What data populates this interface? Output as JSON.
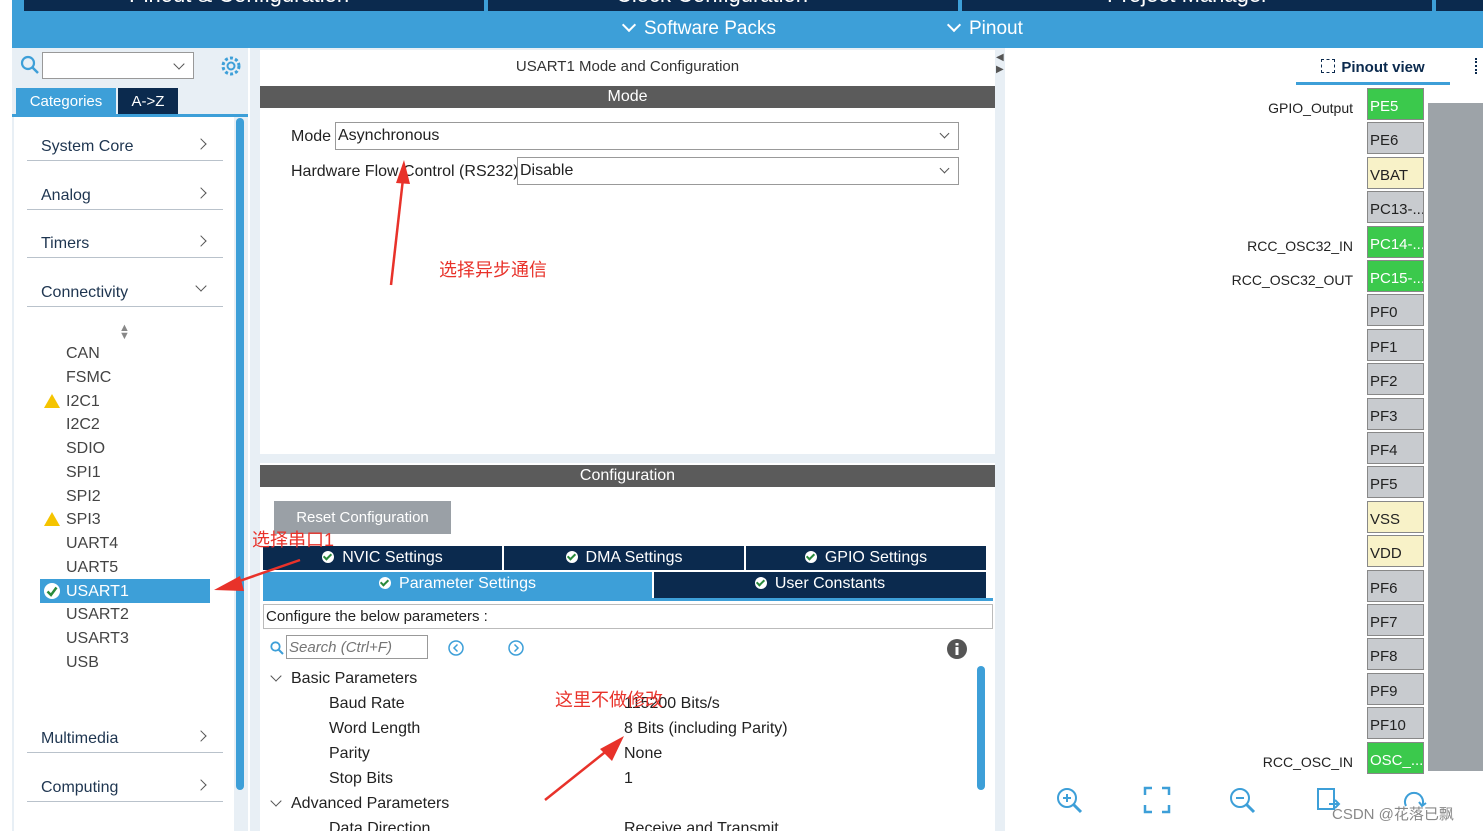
{
  "header": {
    "top_tabs": [
      "Pinout & Configuration",
      "Clock Configuration",
      "Project Manager"
    ],
    "sub_nav": [
      "Software Packs",
      "Pinout"
    ]
  },
  "left": {
    "search_value": "",
    "tabs": [
      "Categories",
      "A->Z"
    ],
    "categories": [
      "System Core",
      "Analog",
      "Timers",
      "Connectivity",
      "Multimedia",
      "Computing"
    ],
    "connectivity_items": [
      "CAN",
      "FSMC",
      "I2C1",
      "I2C2",
      "SDIO",
      "SPI1",
      "SPI2",
      "SPI3",
      "UART4",
      "UART5",
      "USART1",
      "USART2",
      "USART3",
      "USB"
    ],
    "warnings": [
      "I2C1",
      "SPI3"
    ],
    "selected": "USART1"
  },
  "middle": {
    "title": "USART1 Mode and Configuration",
    "mode_bar": "Mode",
    "mode_label": "Mode",
    "mode_value": "Asynchronous",
    "flow_label": "Hardware Flow Control (RS232)",
    "flow_value": "Disable",
    "config_bar": "Configuration",
    "reset_btn": "Reset Configuration",
    "tabs_row1": [
      "NVIC Settings",
      "DMA Settings",
      "GPIO Settings"
    ],
    "tabs_row2": [
      "Parameter Settings",
      "User Constants"
    ],
    "configure_text": "Configure the below parameters :",
    "search_placeholder": "Search (Ctrl+F)",
    "basic_section": "Basic Parameters",
    "params": [
      {
        "label": "Baud Rate",
        "value": "115200 Bits/s"
      },
      {
        "label": "Word Length",
        "value": "8 Bits (including Parity)"
      },
      {
        "label": "Parity",
        "value": "None"
      },
      {
        "label": "Stop Bits",
        "value": "1"
      }
    ],
    "advanced_section": "Advanced Parameters",
    "advanced_first": {
      "label": "Data Direction",
      "value": "Receive and Transmit"
    }
  },
  "right": {
    "view_tab": "Pinout view",
    "pins": [
      {
        "name": "PE5",
        "signal": "GPIO_Output",
        "style": "green"
      },
      {
        "name": "PE6",
        "signal": "",
        "style": "gray"
      },
      {
        "name": "VBAT",
        "signal": "",
        "style": "yellow"
      },
      {
        "name": "PC13-...",
        "signal": "",
        "style": "gray"
      },
      {
        "name": "PC14-...",
        "signal": "RCC_OSC32_IN",
        "style": "green"
      },
      {
        "name": "PC15-...",
        "signal": "RCC_OSC32_OUT",
        "style": "green"
      },
      {
        "name": "PF0",
        "signal": "",
        "style": "gray"
      },
      {
        "name": "PF1",
        "signal": "",
        "style": "gray"
      },
      {
        "name": "PF2",
        "signal": "",
        "style": "gray"
      },
      {
        "name": "PF3",
        "signal": "",
        "style": "gray"
      },
      {
        "name": "PF4",
        "signal": "",
        "style": "gray"
      },
      {
        "name": "PF5",
        "signal": "",
        "style": "gray"
      },
      {
        "name": "VSS",
        "signal": "",
        "style": "yellow"
      },
      {
        "name": "VDD",
        "signal": "",
        "style": "yellow"
      },
      {
        "name": "PF6",
        "signal": "",
        "style": "gray"
      },
      {
        "name": "PF7",
        "signal": "",
        "style": "gray"
      },
      {
        "name": "PF8",
        "signal": "",
        "style": "gray"
      },
      {
        "name": "PF9",
        "signal": "",
        "style": "gray"
      },
      {
        "name": "PF10",
        "signal": "",
        "style": "gray"
      },
      {
        "name": "OSC_...",
        "signal": "RCC_OSC_IN",
        "style": "green"
      }
    ]
  },
  "annotations": {
    "async": "选择异步通信",
    "serial": "选择串口1",
    "nochange": "这里不做修改"
  },
  "watermark": "CSDN @花落已飘"
}
